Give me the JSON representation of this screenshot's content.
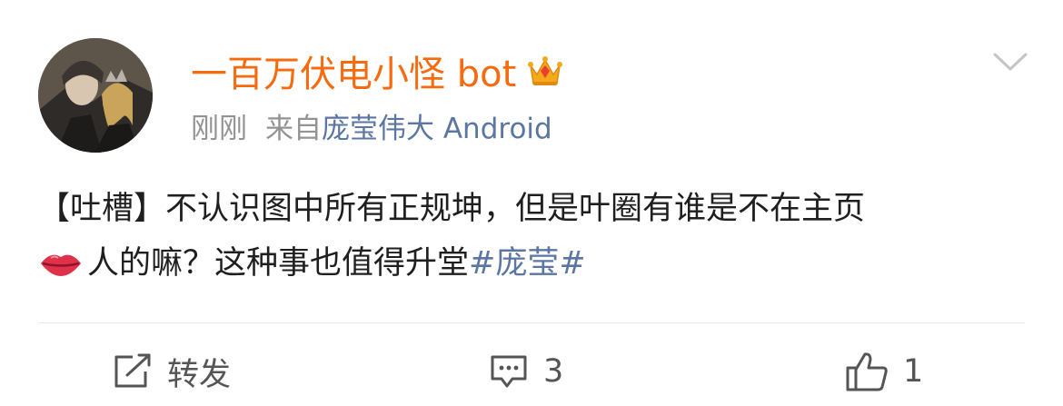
{
  "post": {
    "username": "一百万伏电小怪 bot",
    "time": "刚刚",
    "source_prefix": "来自",
    "source_name": "庞莹伟大 Android",
    "content_line1": "【吐槽】不认识图中所有正规坤，但是叶圈有谁是不在主页",
    "content_line2": "人的嘛？这种事也值得升堂",
    "hashtag": "#庞莹#"
  },
  "actions": {
    "repost_label": "转发",
    "comment_count": "3",
    "like_count": "1"
  },
  "icons": {
    "crown": "crown-badge-icon",
    "chevron": "chevron-down-icon",
    "lips": "lips-emoji-icon",
    "repost": "repost-icon",
    "comment": "comment-icon",
    "like": "thumbs-up-icon"
  },
  "colors": {
    "username": "#f56b0e",
    "link": "#5b76a3",
    "meta": "#939393",
    "text": "#1f1f1f"
  }
}
